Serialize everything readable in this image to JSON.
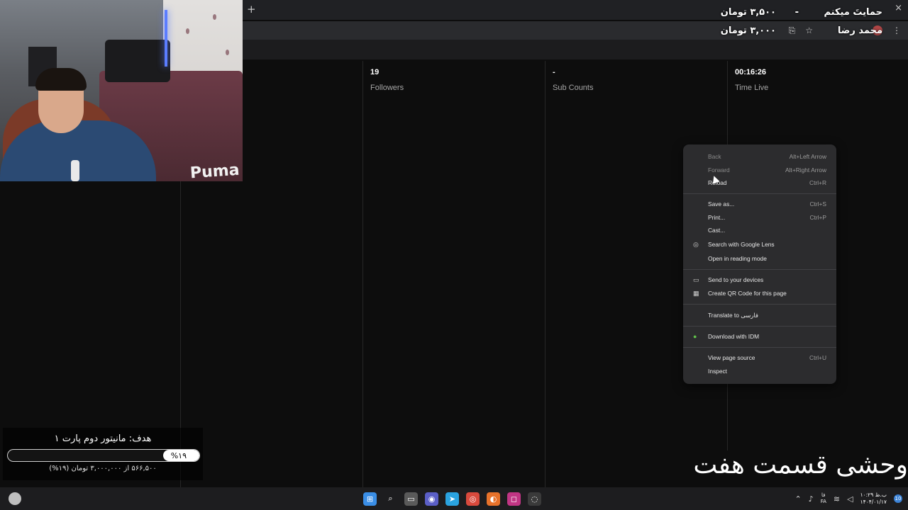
{
  "browser": {
    "new_tab_glyph": "+",
    "close_glyph": "×",
    "menu_glyph": "⋮",
    "star_glyph": "☆",
    "translate_glyph": "⎘"
  },
  "donation": {
    "rows": [
      {
        "name": "حمایتَ میکنم",
        "separator": "-",
        "amount": "۳,۵۰۰ تومان"
      },
      {
        "name": "محمد رضا",
        "separator": "",
        "amount": "۳,۰۰۰ تومان"
      }
    ]
  },
  "stats": [
    {
      "value": "19",
      "label": "Followers"
    },
    {
      "value": "-",
      "label": "Sub Counts"
    },
    {
      "value": "00:16:26",
      "label": "Time Live"
    }
  ],
  "context_menu": {
    "groups": [
      [
        {
          "label": "Back",
          "shortcut": "Alt+Left Arrow",
          "disabled": true
        },
        {
          "label": "Forward",
          "shortcut": "Alt+Right Arrow",
          "disabled": true
        },
        {
          "label": "Reload",
          "shortcut": "Ctrl+R",
          "disabled": false
        }
      ],
      [
        {
          "label": "Save as...",
          "shortcut": "Ctrl+S"
        },
        {
          "label": "Print...",
          "shortcut": "Ctrl+P"
        },
        {
          "label": "Cast...",
          "shortcut": ""
        },
        {
          "label": "Search with Google Lens",
          "shortcut": "",
          "icon": "lens-icon"
        },
        {
          "label": "Open in reading mode",
          "shortcut": ""
        }
      ],
      [
        {
          "label": "Send to your devices",
          "shortcut": "",
          "icon": "devices-icon"
        },
        {
          "label": "Create QR Code for this page",
          "shortcut": "",
          "icon": "qr-code-icon"
        }
      ],
      [
        {
          "label": "Translate to فارسی",
          "shortcut": ""
        }
      ],
      [
        {
          "label": "Download with IDM",
          "shortcut": "",
          "icon": "idm-icon"
        }
      ],
      [
        {
          "label": "View page source",
          "shortcut": "Ctrl+U"
        },
        {
          "label": "Inspect",
          "shortcut": ""
        }
      ]
    ]
  },
  "goal": {
    "title": "هدف: مانیتور دوم پارت ۱",
    "percent_label": "%۱۹",
    "progress": 0.19,
    "detail": "۵۶۶,۵۰۰ از ۳,۰۰۰,۰۰۰ تومان (۱۹%)"
  },
  "episode_caption": "وحشی قسمت هفت",
  "webcam": {
    "brand_text": "Puma"
  },
  "taskbar": {
    "apps": [
      {
        "name": "windows-start-icon",
        "color": "#3a8ee6",
        "glyph": "⊞"
      },
      {
        "name": "search-icon",
        "color": "transparent",
        "glyph": "⌕"
      },
      {
        "name": "file-explorer-icon",
        "color": "#5a5a5a",
        "glyph": "▭"
      },
      {
        "name": "teams-icon",
        "color": "#5b5fc7",
        "glyph": "◉"
      },
      {
        "name": "telegram-icon",
        "color": "#2aa3e0",
        "glyph": "➤"
      },
      {
        "name": "chrome-icon",
        "color": "#d94a3d",
        "glyph": "◎"
      },
      {
        "name": "firefox-icon",
        "color": "#e8722a",
        "glyph": "◐"
      },
      {
        "name": "instagram-icon",
        "color": "#c13584",
        "glyph": "◻"
      },
      {
        "name": "obs-icon",
        "color": "#3a3a3a",
        "glyph": "◌"
      }
    ],
    "tray": {
      "lang_top": "فا",
      "lang_bottom": "FA",
      "time": "۱۰:۲۹ ب.ظ",
      "date": "۱۴۰۴/۰۱/۱۷",
      "notification_count": "10"
    }
  }
}
